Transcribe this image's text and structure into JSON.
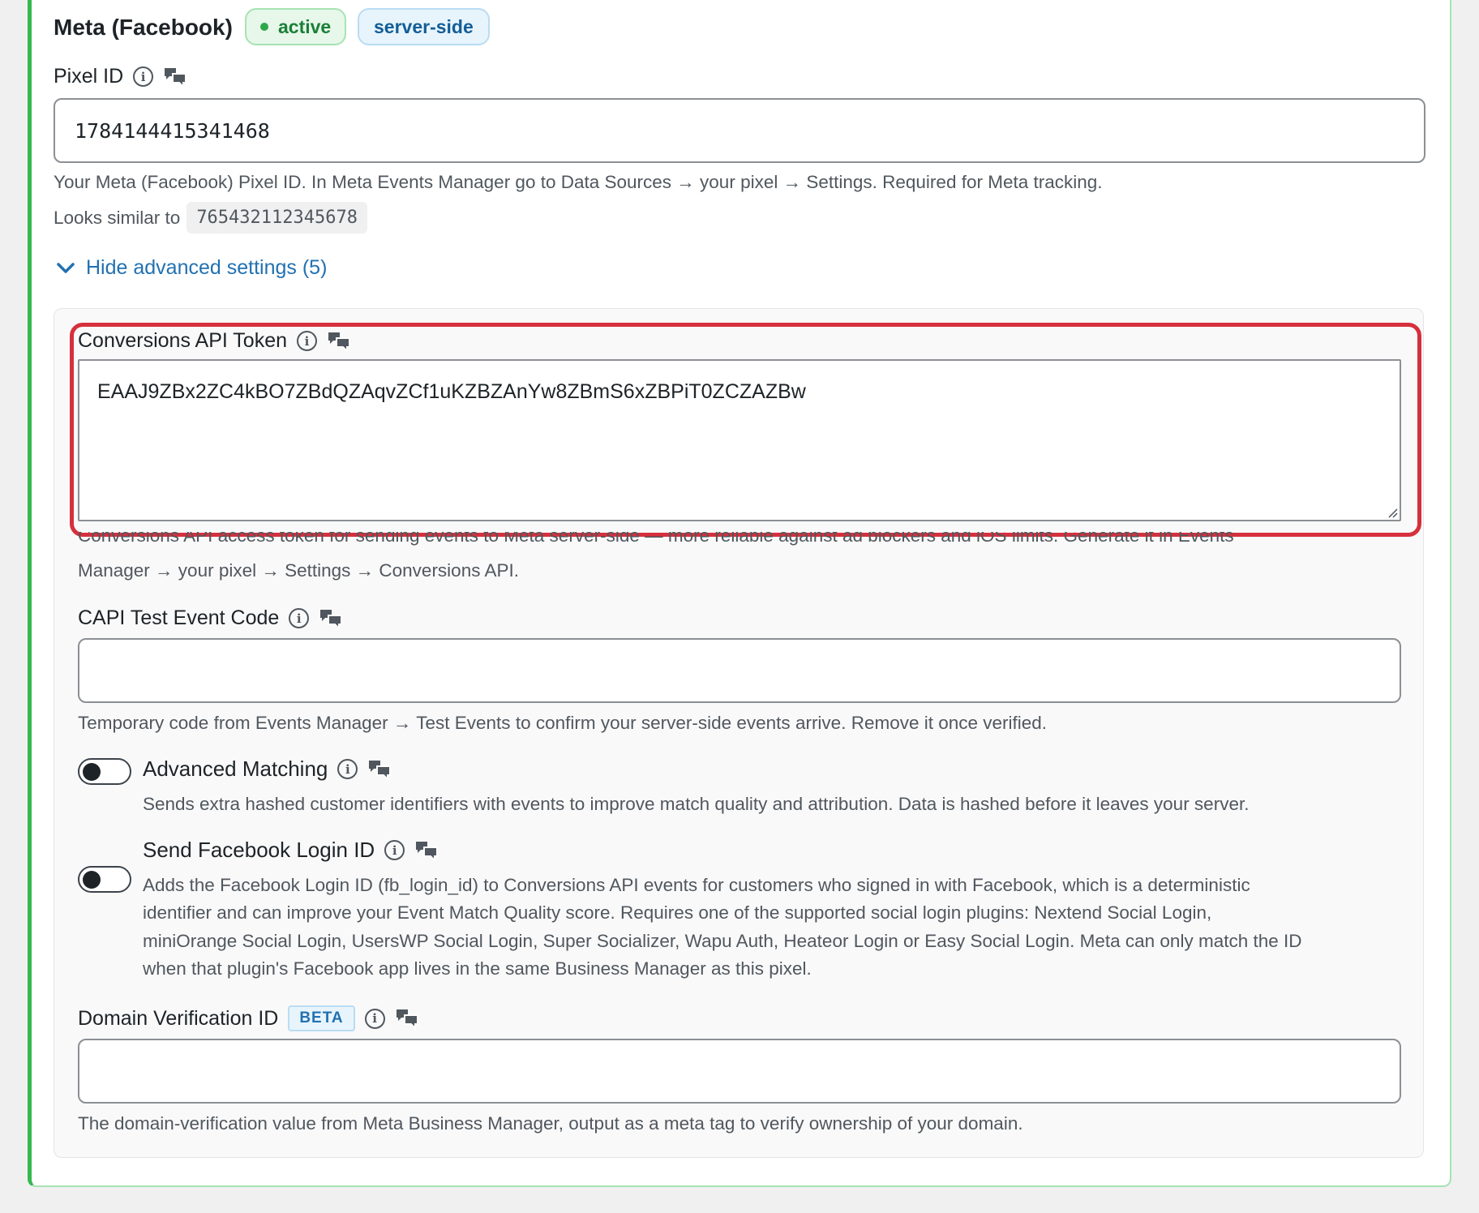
{
  "header": {
    "title": "Meta (Facebook)",
    "status_badge": "active",
    "mode_badge": "server-side"
  },
  "pixel_id": {
    "label": "Pixel ID",
    "value": "1784144415341468",
    "help": "Your Meta (Facebook) Pixel ID. In Meta Events Manager go to Data Sources → your pixel → Settings. Required for Meta tracking.",
    "similar_label": "Looks similar to",
    "similar_example": "765432112345678"
  },
  "advanced_toggle": {
    "label": "Hide advanced settings (5)"
  },
  "capi_token": {
    "label": "Conversions API Token",
    "value": "EAAJ9ZBx2ZC4kBO7ZBdQZAqvZCf1uKZBZAnYw8ZBmS6xZBPiT0ZCZAZBw",
    "help_line1": "Conversions API access token for sending events to Meta server-side — more reliable against ad blockers and iOS limits. Generate it in Events",
    "help_line2": "Manager → your pixel → Settings → Conversions API."
  },
  "capi_test_code": {
    "label": "CAPI Test Event Code",
    "value": "",
    "help": "Temporary code from Events Manager → Test Events to confirm your server-side events arrive. Remove it once verified."
  },
  "advanced_matching": {
    "label": "Advanced Matching",
    "help": "Sends extra hashed customer identifiers with events to improve match quality and attribution. Data is hashed before it leaves your server."
  },
  "fb_login_id": {
    "label": "Send Facebook Login ID",
    "help_lines": [
      "Adds the Facebook Login ID (fb_login_id) to Conversions API events for customers who signed in with Facebook, which is a deterministic",
      "identifier and can improve your Event Match Quality score. Requires one of the supported social login plugins: Nextend Social Login,",
      "miniOrange Social Login, UsersWP Social Login, Super Socializer, Wapu Auth, Heateor Login or Easy Social Login. Meta can only match the ID",
      "when that plugin's Facebook app lives in the same Business Manager as this pixel."
    ]
  },
  "domain_verification": {
    "label": "Domain Verification ID",
    "beta_badge": "BETA",
    "value": "",
    "help": "The domain-verification value from Meta Business Manager, output as a meta tag to verify ownership of your domain."
  },
  "icons": {
    "info": "info-icon",
    "chat": "chat-bubbles-icon",
    "chevron": "chevron-down-icon"
  }
}
